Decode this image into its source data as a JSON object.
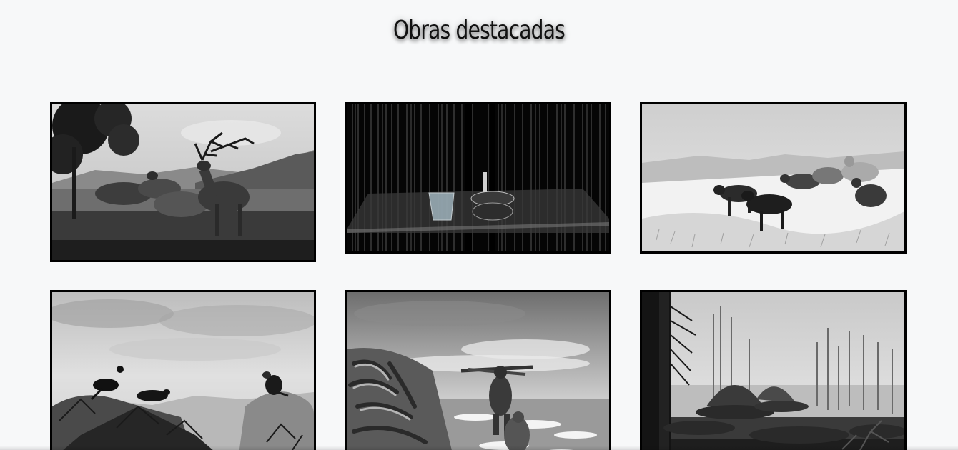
{
  "page": {
    "title": "Obras destacadas"
  },
  "gallery": {
    "items": [
      {
        "subject": "elk-diorama"
      },
      {
        "subject": "rain-installation"
      },
      {
        "subject": "wolves-diorama"
      },
      {
        "subject": "vultures-diorama"
      },
      {
        "subject": "prehistoric-figures-diorama"
      },
      {
        "subject": "dimetrodon-diorama"
      }
    ]
  },
  "colors": {
    "background": "#f7f8f9",
    "frame": "#000000",
    "title": "#111111"
  }
}
